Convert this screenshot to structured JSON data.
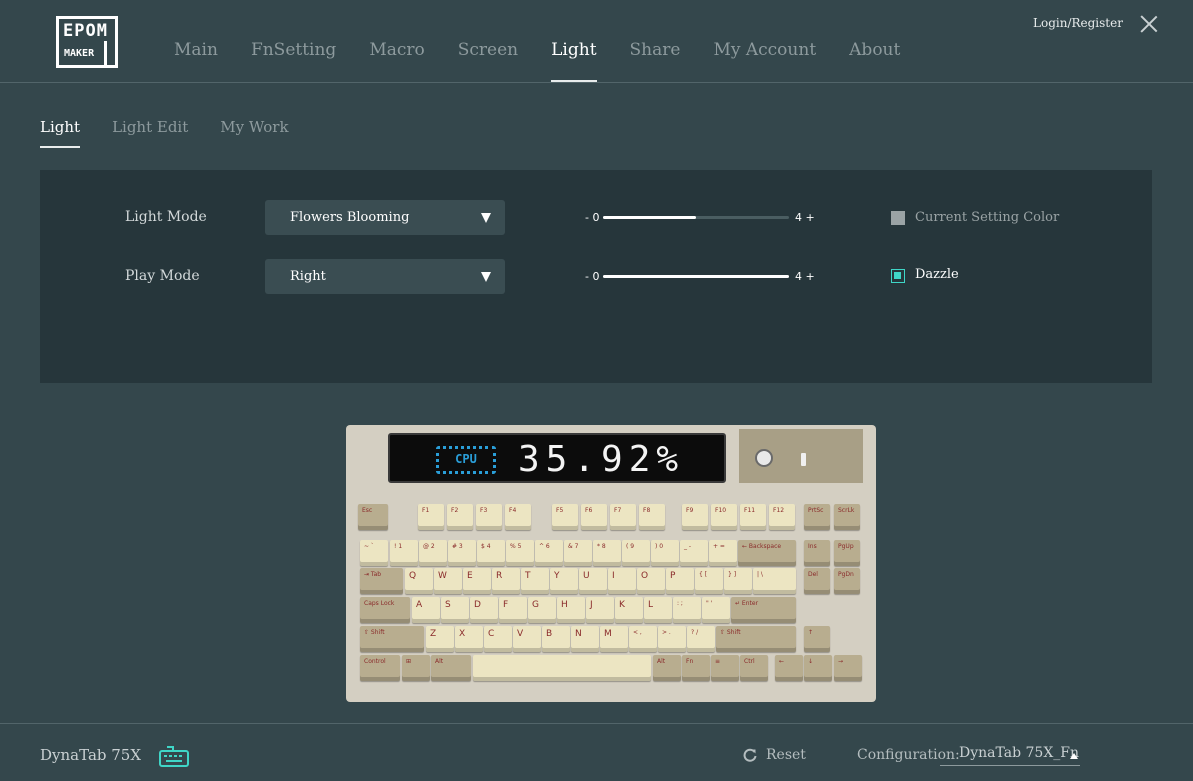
{
  "brand": {
    "logo_top": "EPOM",
    "logo_bottom": "MAKER"
  },
  "nav": {
    "items": [
      {
        "label": "Main",
        "active": false
      },
      {
        "label": "FnSetting",
        "active": false
      },
      {
        "label": "Macro",
        "active": false
      },
      {
        "label": "Screen",
        "active": false
      },
      {
        "label": "Light",
        "active": true
      },
      {
        "label": "Share",
        "active": false
      },
      {
        "label": "My Account",
        "active": false
      },
      {
        "label": "About",
        "active": false
      }
    ],
    "login": "Login/Register"
  },
  "subtabs": [
    {
      "label": "Light",
      "active": true
    },
    {
      "label": "Light Edit",
      "active": false
    },
    {
      "label": "My Work",
      "active": false
    }
  ],
  "panel": {
    "light_mode": {
      "label": "Light Mode",
      "value": "Flowers Blooming",
      "slider_min": "- 0",
      "slider_max": "4 +",
      "slider_level": 0.5,
      "option_label": "Current Setting Color",
      "option_checked": false
    },
    "play_mode": {
      "label": "Play Mode",
      "value": "Right",
      "slider_min": "- 0",
      "slider_max": "4 +",
      "slider_level": 1.0,
      "option_label": "Dazzle",
      "option_checked": true
    }
  },
  "keyboard": {
    "screen_icon": "CPU",
    "screen_text": "35.92%",
    "rows": {
      "r0": [
        "Esc",
        "F1",
        "F2",
        "F3",
        "F4",
        "F5",
        "F6",
        "F7",
        "F8",
        "F9",
        "F10",
        "F11",
        "F12",
        "PrtSc",
        "ScrLk"
      ],
      "r1": [
        "~ `",
        "! 1",
        "@ 2",
        "# 3",
        "$ 4",
        "% 5",
        "^ 6",
        "& 7",
        "* 8",
        "( 9",
        ") 0",
        "_ -",
        "+ =",
        "← Backspace",
        "Ins",
        "PgUp"
      ],
      "r2": [
        "⇥ Tab",
        "Q",
        "W",
        "E",
        "R",
        "T",
        "Y",
        "U",
        "I",
        "O",
        "P",
        "{ [",
        "} ]",
        "| \\",
        "Del",
        "PgDn"
      ],
      "r3": [
        "Caps Lock",
        "A",
        "S",
        "D",
        "F",
        "G",
        "H",
        "J",
        "K",
        "L",
        ": ;",
        "\" '",
        "↵ Enter"
      ],
      "r4": [
        "⇧ Shift",
        "Z",
        "X",
        "C",
        "V",
        "B",
        "N",
        "M",
        "< ,",
        "> .",
        "? /",
        "⇧ Shift",
        "↑"
      ],
      "r5": [
        "Control",
        "⊞",
        "Alt",
        "",
        "Alt",
        "Fn",
        "≡",
        "Ctrl",
        "←",
        "↓",
        "→"
      ]
    }
  },
  "footer": {
    "device": "DynaTab 75X",
    "reset": "Reset",
    "config_label": "Configuration:",
    "config_value": "DynaTab 75X_Fn"
  },
  "colors": {
    "background": "#34474c",
    "panel": "#26363b",
    "accent": "#3fd6c7"
  }
}
